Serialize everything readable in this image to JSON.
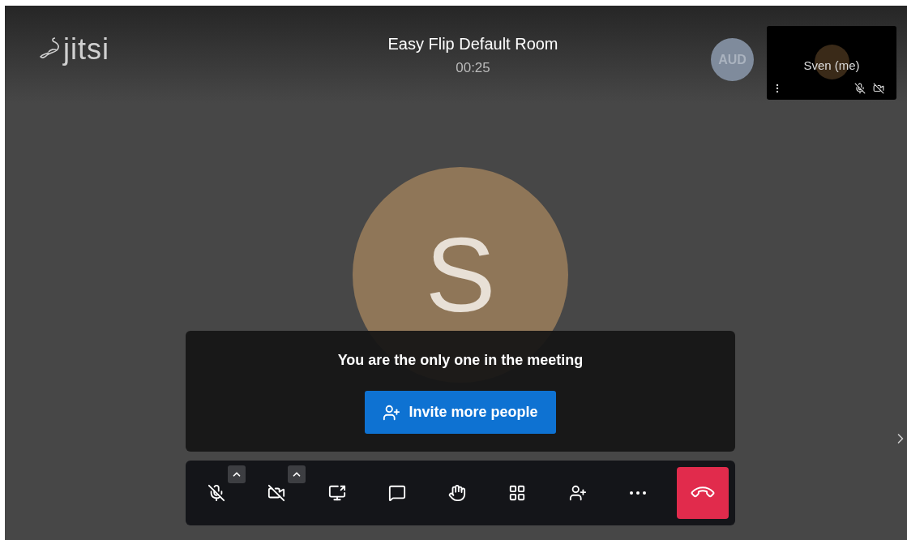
{
  "header": {
    "logo": "jitsi",
    "title": "Easy Flip Default Room",
    "timer": "00:25"
  },
  "participants": [
    {
      "initials": "AUD"
    }
  ],
  "self_view": {
    "name": "Sven (me)",
    "mic_muted": true,
    "video_off": true
  },
  "main_avatar": {
    "initial": "S"
  },
  "notice": {
    "message": "You are the only one in the meeting",
    "button": "Invite more people"
  },
  "toolbar": [
    {
      "kind": "mic",
      "muted": true,
      "has_menu": true
    },
    {
      "kind": "camera",
      "muted": true,
      "has_menu": true
    },
    {
      "kind": "share"
    },
    {
      "kind": "chat"
    },
    {
      "kind": "hand"
    },
    {
      "kind": "tiles"
    },
    {
      "kind": "invite"
    },
    {
      "kind": "more"
    },
    {
      "kind": "hangup"
    }
  ]
}
